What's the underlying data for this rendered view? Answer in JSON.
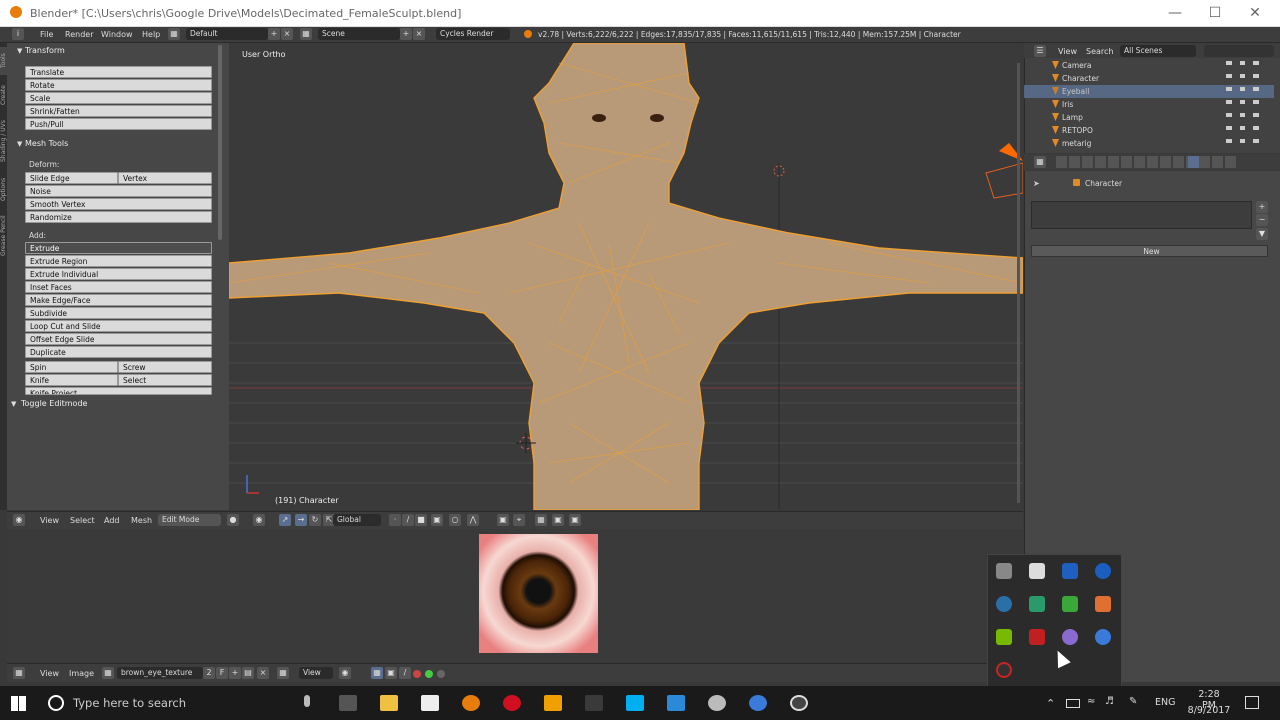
{
  "window": {
    "title": "Blender* [C:\\Users\\chris\\Google Drive\\Models\\Decimated_FemaleSculpt.blend]",
    "minimize_icon": "minimize-icon",
    "maximize_icon": "maximize-icon",
    "close_icon": "close-icon"
  },
  "info_header": {
    "menus": [
      "File",
      "Render",
      "Window",
      "Help"
    ],
    "layout": "Default",
    "scene": "Scene",
    "engine": "Cycles Render",
    "stats": "v2.78 | Verts:6,222/6,222 | Edges:17,835/17,835 | Faces:11,615/11,615 | Tris:12,440 | Mem:157.25M | Character"
  },
  "tool_tabs": [
    "Tools",
    "Create",
    "Shading / UVs",
    "Options",
    "Grease Pencil"
  ],
  "tool_shelf": {
    "transform_header": "Transform",
    "transform_buttons": [
      "Translate",
      "Rotate",
      "Scale",
      "Shrink/Fatten",
      "Push/Pull"
    ],
    "mesh_tools_header": "Mesh Tools",
    "deform_label": "Deform:",
    "slide_edge": "Slide Edge",
    "vertex": "Vertex",
    "noise": "Noise",
    "smooth_vertex": "Smooth Vertex",
    "randomize": "Randomize",
    "add_label": "Add:",
    "extrude": "Extrude",
    "add_buttons": [
      "Extrude Region",
      "Extrude Individual",
      "Inset Faces",
      "Make Edge/Face",
      "Subdivide",
      "Loop Cut and Slide",
      "Offset Edge Slide",
      "Duplicate"
    ],
    "spin": "Spin",
    "screw": "Screw",
    "knife": "Knife",
    "select": "Select",
    "knife_project": "Knife Project",
    "toggle_editmode": "Toggle Editmode"
  },
  "viewport": {
    "view_label": "User Ortho",
    "object_label": "(191) Character",
    "header_menus": [
      "View",
      "Select",
      "Add",
      "Mesh"
    ],
    "mode": "Edit Mode",
    "orientation": "Global"
  },
  "image_editor": {
    "menus": [
      "View",
      "Image"
    ],
    "image_name": "brown_eye_texture",
    "users": "2",
    "fake_user": "F",
    "view_menu": "View"
  },
  "outliner": {
    "view_menu": "View",
    "search_menu": "Search",
    "scope": "All Scenes",
    "items": [
      "Camera",
      "Character",
      "Eyeball",
      "Iris",
      "Lamp",
      "RETOPO",
      "metarig"
    ]
  },
  "properties": {
    "context": "Character",
    "new_button": "New"
  },
  "taskbar": {
    "search_placeholder": "Type here to search",
    "language": "ENG",
    "time": "2:28 PM",
    "date": "8/9/2017"
  },
  "colors": {
    "mesh_orange": "#f0a030",
    "selected_row": "#5a6f8f",
    "taskbar": "#1a1a1a"
  }
}
